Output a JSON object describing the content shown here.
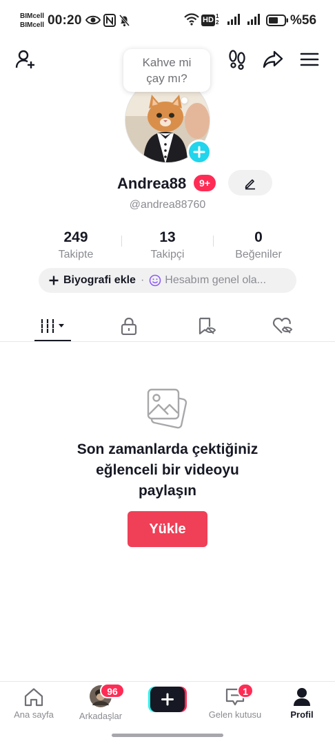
{
  "status_bar": {
    "carrier_1": "BIMcell",
    "carrier_2": "BIMcell",
    "time": "00:20",
    "network_badge": "HD",
    "battery_percent": "%56"
  },
  "header": {
    "icons": [
      "add-friend-icon",
      "footprints-icon",
      "share-icon",
      "menu-icon"
    ]
  },
  "note": {
    "text_line1": "Kahve mi",
    "text_line2": "çay mı?"
  },
  "profile": {
    "username": "Andrea88",
    "notification_badge": "9+",
    "handle": "@andrea88760"
  },
  "stats": [
    {
      "value": "249",
      "label": "Takipte"
    },
    {
      "value": "13",
      "label": "Takipçi"
    },
    {
      "value": "0",
      "label": "Beğeniler"
    }
  ],
  "bio": {
    "add_label": "Biyografi ekle",
    "separator": "·",
    "status_label": "Hesabım genel ola..."
  },
  "tabs": [
    {
      "icon": "videos-grid-icon",
      "active": true
    },
    {
      "icon": "lock-icon",
      "active": false
    },
    {
      "icon": "saved-hidden-icon",
      "active": false
    },
    {
      "icon": "liked-hidden-icon",
      "active": false
    }
  ],
  "empty_state": {
    "line1": "Son zamanlarda çektiğiniz",
    "line2": "eğlenceli bir videoyu",
    "line3": "paylaşın",
    "button": "Yükle"
  },
  "bottom_nav": {
    "home": "Ana sayfa",
    "friends": "Arkadaşlar",
    "friends_badge": "96",
    "inbox": "Gelen kutusu",
    "inbox_badge": "1",
    "profile": "Profil"
  },
  "colors": {
    "accent": "#fe2c55",
    "upload_button": "#ef4057",
    "avatar_add": "#20d5ec"
  }
}
